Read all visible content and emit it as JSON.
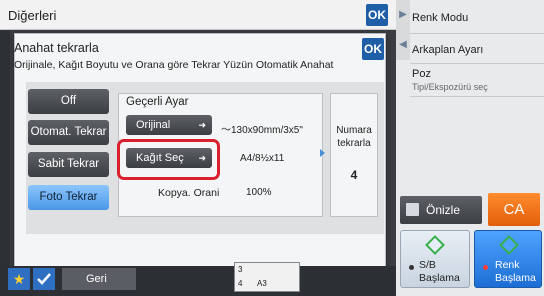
{
  "top_bar": {
    "title": "Diğerleri",
    "ok_label": "OK"
  },
  "dialog": {
    "title": "Anahat tekrarla",
    "description": "Orijinale, Kağıt Boyutu ve Orana göre Tekrar Yüzün Otomatik Anahat",
    "ok_label": "OK",
    "modes": [
      {
        "label": "Off",
        "active": false
      },
      {
        "label": "Otomat. Tekrar",
        "active": false
      },
      {
        "label": "Sabit Tekrar",
        "active": false
      },
      {
        "label": "Foto Tekrar",
        "active": true
      }
    ],
    "settings": {
      "label": "Geçerli Ayar",
      "original_button": "Orijinal",
      "original_value": "～130x90mm/3x5\"",
      "paper_button": "Kağıt Seç",
      "paper_value": "A4/8½x11",
      "ratio_label": "Kopya. Orani",
      "ratio_value": "100%"
    },
    "number": {
      "label_line1": "Numara",
      "label_line2": "tekrarla",
      "value": "4"
    }
  },
  "right_panel": {
    "items": [
      "Renk Modu",
      "Arkaplan Ayarı",
      "Poz"
    ],
    "poz_sub": "Tipi/Ekspozürü seç",
    "preview_label": "Önizle",
    "ca_label": "CA",
    "start_bw_line1": "S/B",
    "start_bw_line2": "Başlama",
    "start_color_line1": "Renk",
    "start_color_line2": "Başlama"
  },
  "bottom_bar": {
    "back_label": "Geri",
    "thumb_top": "3",
    "thumb_bottom": "4",
    "thumb_size": "A3"
  },
  "colors": {
    "accent_blue": "#1f5fa8",
    "active_mode": "#4a97e6",
    "highlight_red": "#d9202d",
    "ca_orange": "#e35e0a",
    "start_green": "#36b04a"
  }
}
